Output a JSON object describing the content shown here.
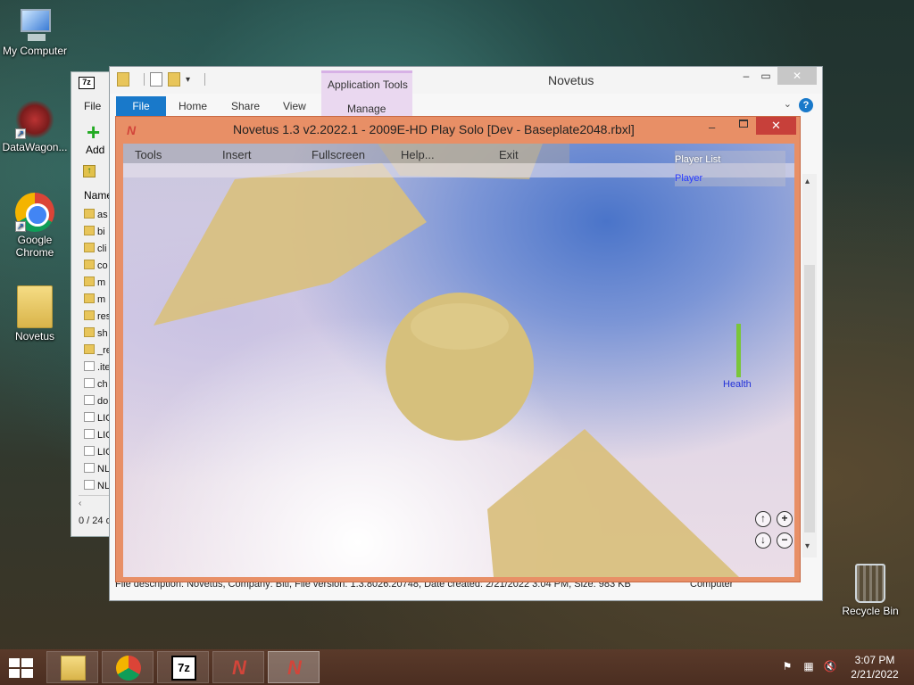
{
  "desktop": {
    "icons": [
      {
        "label": "My Computer"
      },
      {
        "label": "DataWagon..."
      },
      {
        "label": "Google Chrome"
      },
      {
        "label": "Novetus"
      },
      {
        "label": "Recycle Bin"
      }
    ]
  },
  "sevenzip": {
    "menu_file": "File",
    "add_label": "Add",
    "column_name": "Name",
    "rows": [
      {
        "text": "as",
        "kind": "folder"
      },
      {
        "text": "bi",
        "kind": "folder"
      },
      {
        "text": "cli",
        "kind": "folder"
      },
      {
        "text": "co",
        "kind": "folder"
      },
      {
        "text": "m",
        "kind": "folder"
      },
      {
        "text": "m",
        "kind": "folder"
      },
      {
        "text": "res",
        "kind": "folder"
      },
      {
        "text": "sh",
        "kind": "folder"
      },
      {
        "text": "_re",
        "kind": "folder"
      },
      {
        "text": ".ite",
        "kind": "file"
      },
      {
        "text": "ch",
        "kind": "file"
      },
      {
        "text": "do",
        "kind": "file"
      },
      {
        "text": "LIC",
        "kind": "file"
      },
      {
        "text": "LIC",
        "kind": "file"
      },
      {
        "text": "LIC",
        "kind": "file"
      },
      {
        "text": "NL",
        "kind": "file"
      },
      {
        "text": "NL",
        "kind": "file"
      }
    ],
    "status": "0 / 24 o"
  },
  "explorer": {
    "title": "Novetus",
    "app_tools": "Application Tools",
    "tabs": {
      "file": "File",
      "home": "Home",
      "share": "Share",
      "view": "View",
      "manage": "Manage"
    },
    "status_text": "File description: Novetus, Company: Bitl, File version: 1.3.8026.20748, Date created: 2/21/2022 3:04 PM, Size: 983 KB",
    "status_right": "Computer"
  },
  "game": {
    "title": "Novetus 1.3 v2.2022.1 - 2009E-HD Play Solo [Dev - Baseplate2048.rbxl]",
    "menu": {
      "tools": "Tools",
      "insert": "Insert",
      "fullscreen": "Fullscreen",
      "help": "Help...",
      "exit": "Exit"
    },
    "player_list_title": "Player List",
    "player_name": "Player",
    "health_label": "Health",
    "health_level": 1.0
  },
  "taskbar": {
    "time": "3:07 PM",
    "date": "2/21/2022"
  },
  "colors": {
    "game_frame": "#e88f66",
    "close_red": "#c7403a",
    "file_tab_blue": "#1979ca",
    "sand_part": "#d9c07f",
    "health_green": "#7ac63a"
  }
}
